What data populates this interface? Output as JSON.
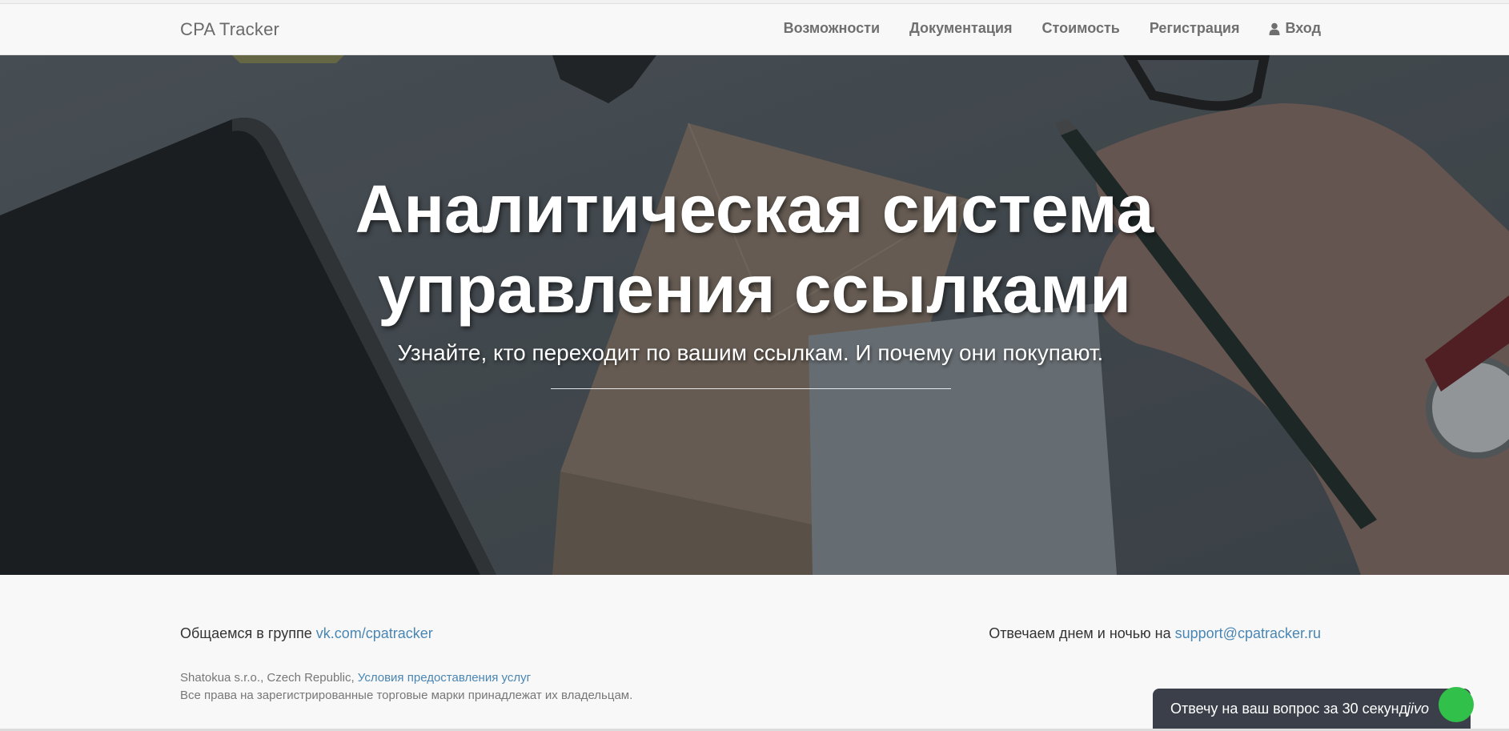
{
  "navbar": {
    "brand": "CPA Tracker",
    "items": [
      {
        "label": "Возможности"
      },
      {
        "label": "Документация"
      },
      {
        "label": "Стоимость"
      },
      {
        "label": "Регистрация"
      },
      {
        "label": "Вход",
        "icon": "user-icon"
      }
    ]
  },
  "hero": {
    "title_line1": "Аналитическая система",
    "title_line2": "управления ссылками",
    "subtitle": "Узнайте, кто переходит по вашим ссылкам. И почему они покупают."
  },
  "footer": {
    "community_text": "Общаемся в группе ",
    "community_link": "vk.com/cpatracker",
    "support_text": "Отвечаем днем и ночью на ",
    "support_link": "support@cpatracker.ru",
    "company": "Shatokua s.r.o., Czech Republic, ",
    "terms_link": "Условия предоставления услуг",
    "rights": "Все права на зарегистрированные торговые марки принадлежат их владельцам."
  },
  "chat": {
    "text": "Отвечу на ваш вопрос за 30 секунд",
    "logo": "jivo"
  },
  "colors": {
    "link": "#4a86b3",
    "chat_bg": "#3a3f4a",
    "chat_accent": "#31c04a"
  }
}
